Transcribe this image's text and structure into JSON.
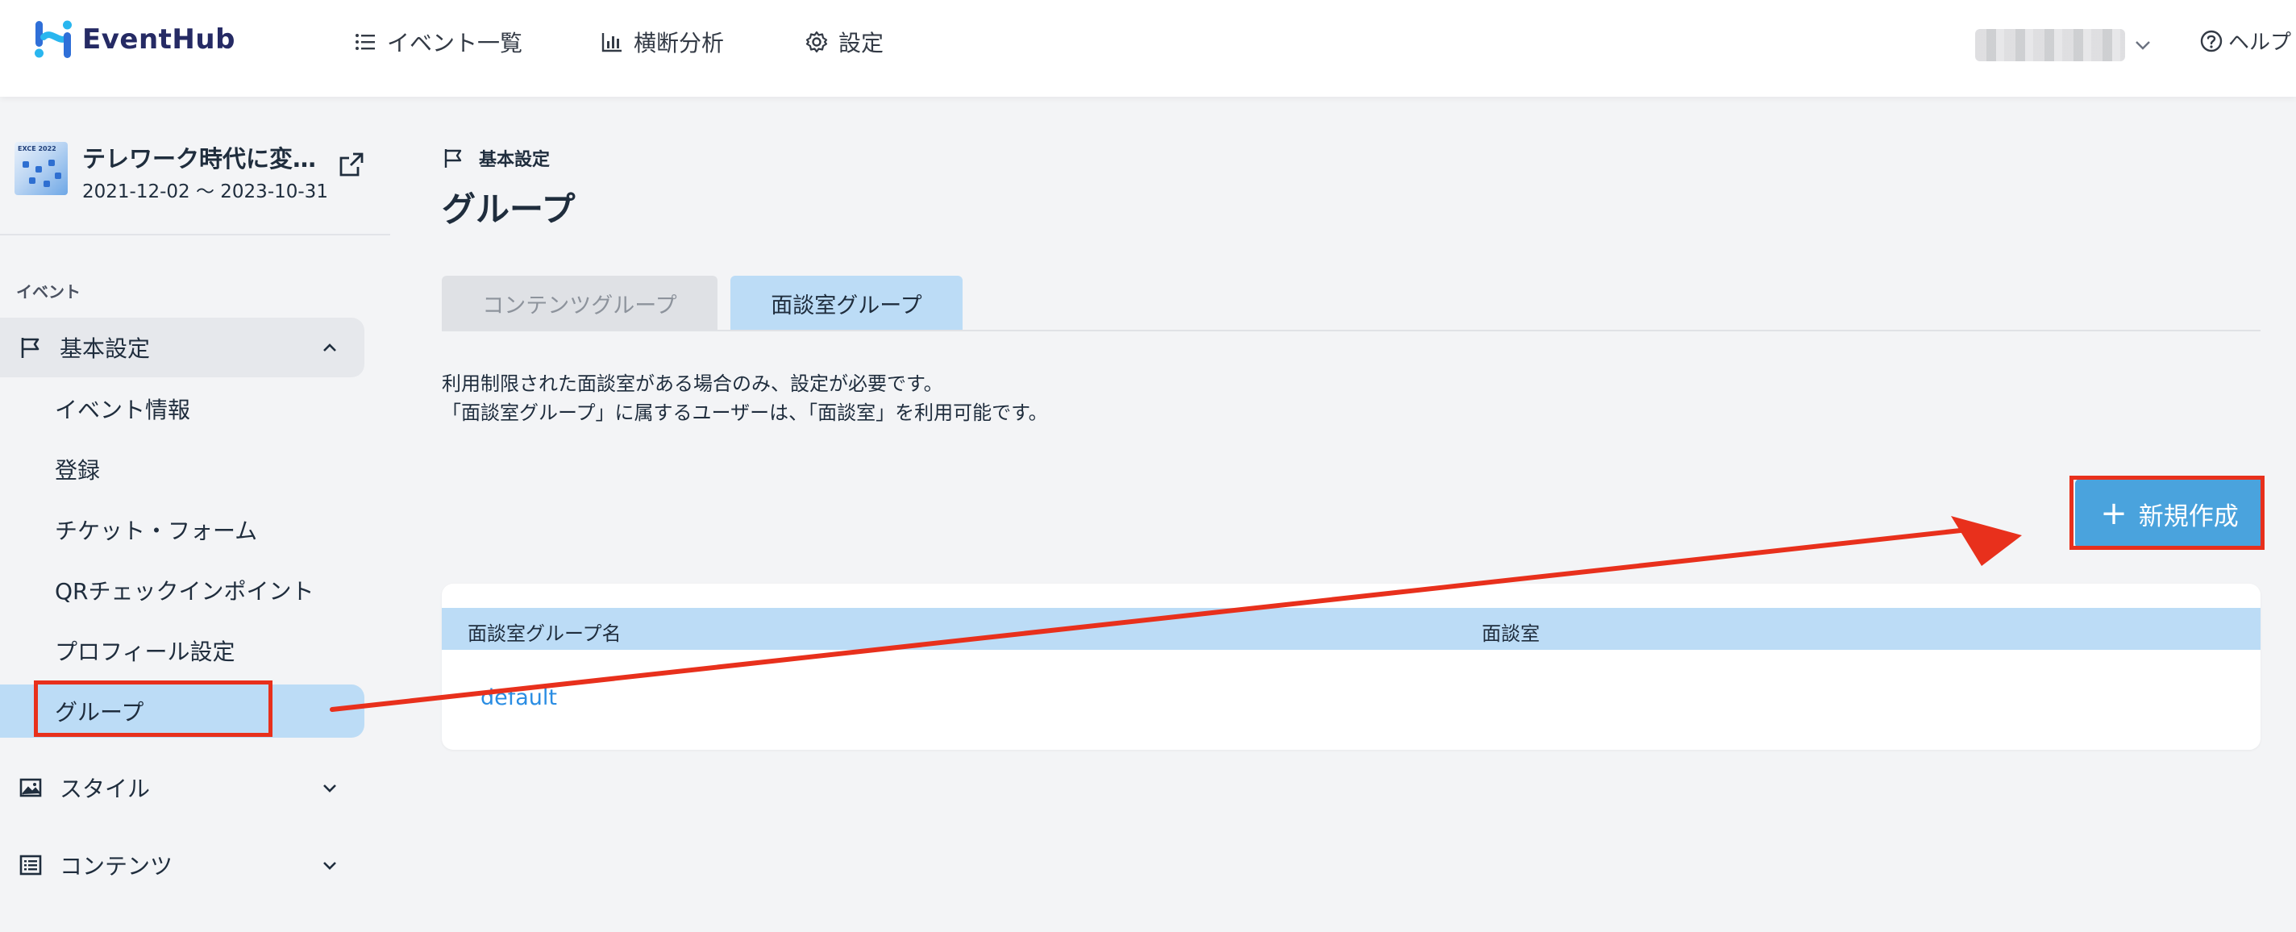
{
  "header": {
    "logo_text": "EventHub",
    "nav": [
      {
        "label": "イベント一覧",
        "icon": "list-icon"
      },
      {
        "label": "横断分析",
        "icon": "bar-chart-icon"
      },
      {
        "label": "設定",
        "icon": "gear-icon"
      }
    ],
    "help_label": "ヘルプ"
  },
  "sidebar": {
    "event": {
      "title": "テレワーク時代に変…",
      "dates": "2021-12-02 〜 2023-10-31",
      "thumb_text": "EXCE 2022"
    },
    "section_label": "イベント",
    "groups": [
      {
        "label": "基本設定",
        "icon": "flag-icon",
        "expanded": true,
        "items": [
          {
            "label": "イベント情報"
          },
          {
            "label": "登録"
          },
          {
            "label": "チケット・フォーム"
          },
          {
            "label": "QRチェックインポイント"
          },
          {
            "label": "プロフィール設定"
          },
          {
            "label": "グループ",
            "active": true
          }
        ]
      },
      {
        "label": "スタイル",
        "icon": "image-icon",
        "expanded": false
      },
      {
        "label": "コンテンツ",
        "icon": "list-box-icon",
        "expanded": false
      }
    ]
  },
  "main": {
    "breadcrumb": "基本設定",
    "title": "グループ",
    "tabs": [
      {
        "label": "コンテンツグループ",
        "active": false
      },
      {
        "label": "面談室グループ",
        "active": true
      }
    ],
    "description": [
      "利用制限された面談室がある場合のみ、設定が必要です。",
      "「面談室グループ」に属するユーザーは、「面談室」を利用可能です。"
    ],
    "new_button_label": "新規作成",
    "table": {
      "columns": [
        "面談室グループ名",
        "面談室"
      ],
      "rows": [
        {
          "name": "default",
          "room": ""
        }
      ]
    }
  },
  "colors": {
    "accent": "#4aa3dd",
    "active_bg": "#bcdcf6",
    "annotation": "#e8301c",
    "link": "#2a8de3",
    "brand": "#252a64"
  }
}
